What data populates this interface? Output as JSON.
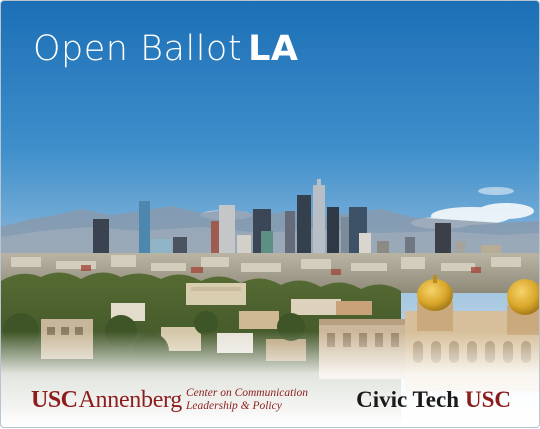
{
  "hero": {
    "title_light": "Open Ballot",
    "title_bold": "LA"
  },
  "footer": {
    "usc_logo": {
      "usc": "USC",
      "annenberg": "Annenberg",
      "center_line1": "Center on Communication",
      "center_line2": "Leadership & Policy"
    },
    "civic_logo": {
      "civic_tech": "Civic Tech",
      "usc": "USC"
    }
  },
  "colors": {
    "sky_top": "#1c6fb6",
    "sky_bottom": "#dfe9f1",
    "usc_cardinal": "#8c1d1d",
    "dome_gold": "#d9a72b"
  }
}
